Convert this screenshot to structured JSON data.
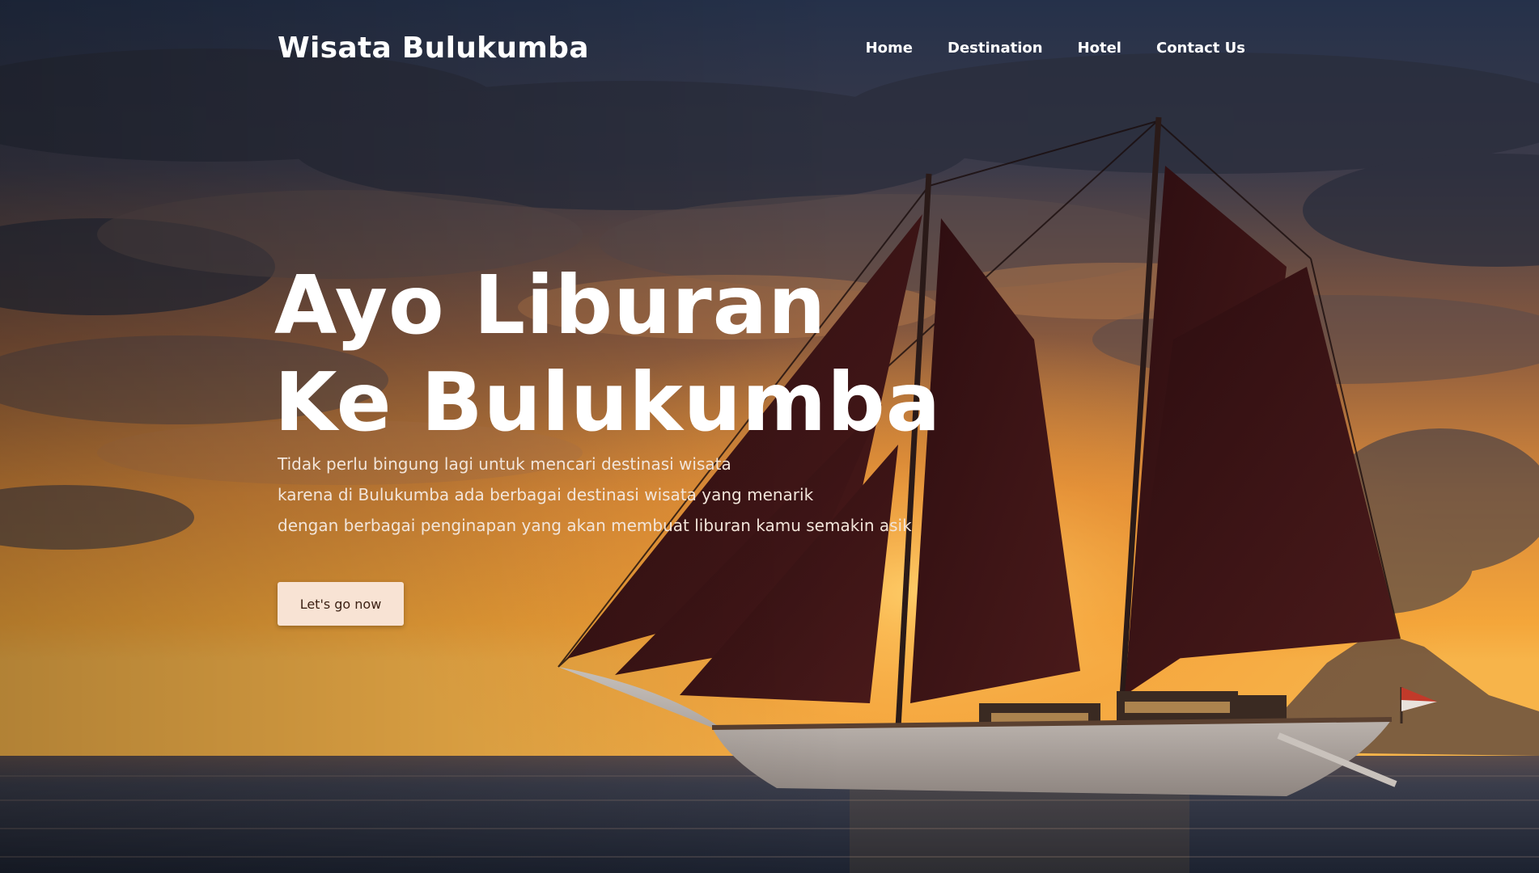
{
  "brand": "Wisata Bulukumba",
  "nav": {
    "home": "Home",
    "destination": "Destination",
    "hotel": "Hotel",
    "contact": "Contact Us"
  },
  "hero": {
    "headline_line1": "Ayo Liburan",
    "headline_line2": "Ke Bulukumba",
    "description_line1": "Tidak perlu bingung lagi untuk mencari destinasi wisata",
    "description_line2": "karena di Bulukumba ada berbagai destinasi wisata yang menarik",
    "description_line3": "dengan berbagai penginapan yang akan membuat liburan kamu semakin asik",
    "cta_label": "Let's go now"
  },
  "colors": {
    "sky_top": "#27334d",
    "sunset": "#f0a23a",
    "sail": "#3d1214",
    "sea": "#2c3444",
    "cta_bg": "#f8e3d4"
  }
}
